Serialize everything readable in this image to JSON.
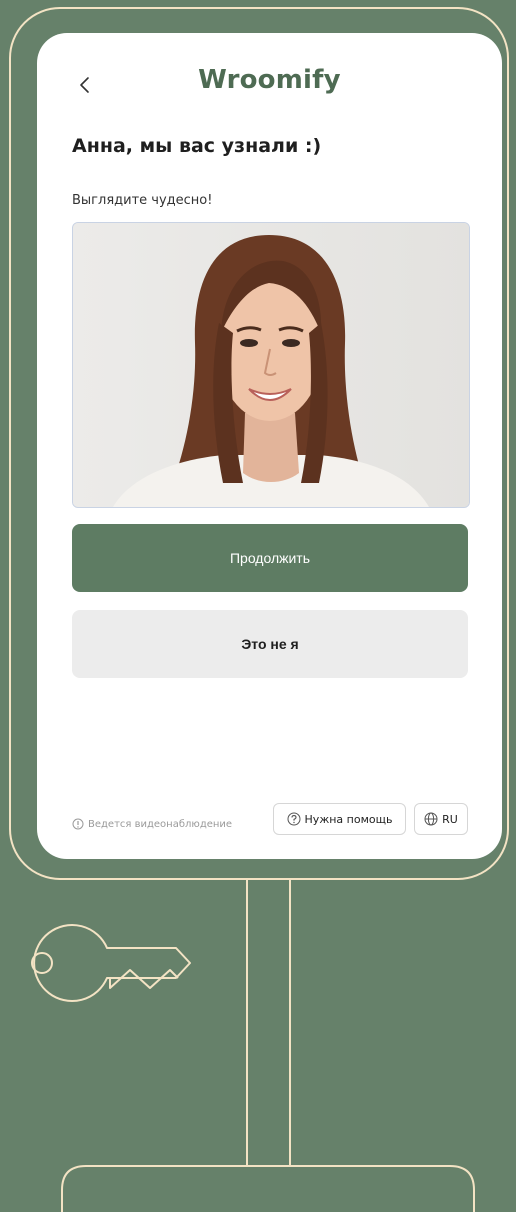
{
  "app": {
    "logo_text": "Wroomify"
  },
  "header": {
    "back_icon": "chevron-left-icon"
  },
  "main": {
    "greeting": "Анна, мы вас узнали :)",
    "subtitle": "Выглядите чудесно!",
    "photo_alt": "smiling woman portrait"
  },
  "actions": {
    "continue_label": "Продолжить",
    "not_me_label": "Это не я"
  },
  "footer": {
    "surveillance_note": "Ведется видеонаблюдение",
    "help_label": "Нужна помощь",
    "language_label": "RU"
  },
  "colors": {
    "background": "#66816a",
    "brand": "#4e6b53",
    "primary_button": "#5e7c63",
    "secondary_button": "#ececec",
    "outline": "#f3e3c4"
  }
}
